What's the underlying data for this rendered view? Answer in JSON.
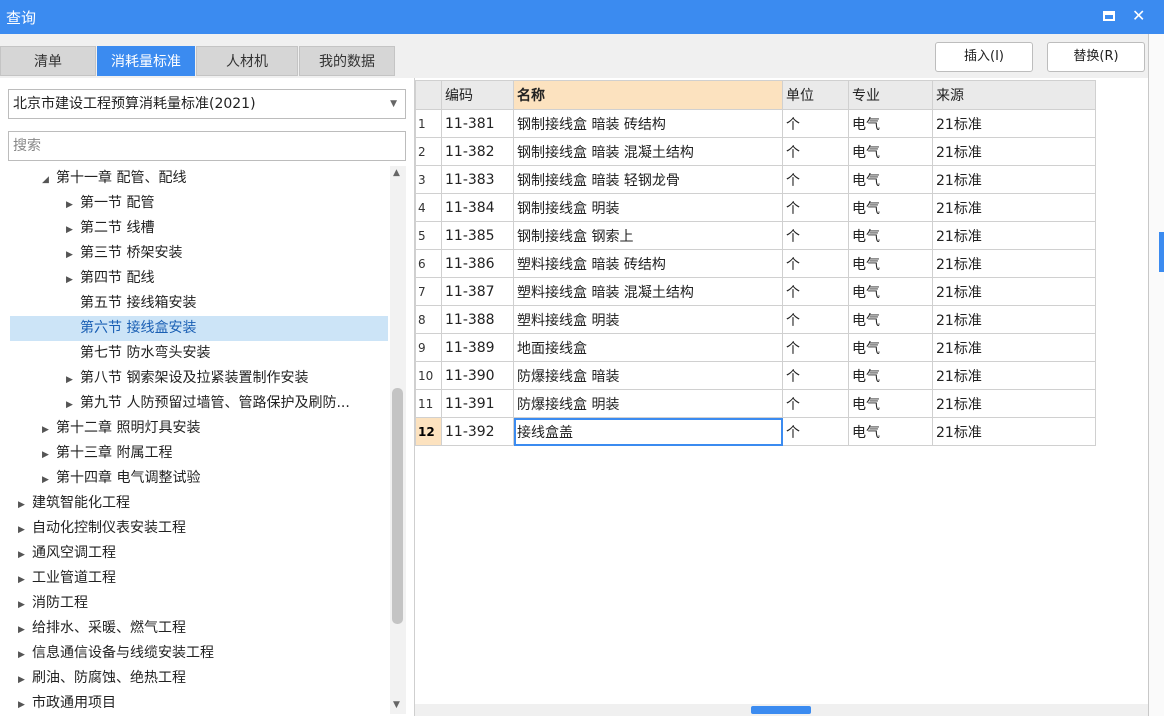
{
  "window": {
    "title": "查询"
  },
  "tabs": [
    {
      "label": "清单",
      "active": false
    },
    {
      "label": "消耗量标准",
      "active": true
    },
    {
      "label": "人材机",
      "active": false
    },
    {
      "label": "我的数据",
      "active": false
    }
  ],
  "actions": {
    "insert_label": "插入(I)",
    "replace_label": "替换(R)"
  },
  "left": {
    "dropdown_value": "北京市建设工程预算消耗量标准(2021)",
    "search_placeholder": "搜索",
    "tree": [
      {
        "label": "第十一章 配管、配线",
        "level": 1,
        "caret": "expanded"
      },
      {
        "label": "第一节 配管",
        "level": 2,
        "caret": "collapsed"
      },
      {
        "label": "第二节 线槽",
        "level": 2,
        "caret": "collapsed"
      },
      {
        "label": "第三节 桥架安装",
        "level": 2,
        "caret": "collapsed"
      },
      {
        "label": "第四节 配线",
        "level": 2,
        "caret": "collapsed"
      },
      {
        "label": "第五节 接线箱安装",
        "level": 2,
        "caret": "none"
      },
      {
        "label": "第六节 接线盒安装",
        "level": 2,
        "caret": "none",
        "selected": true
      },
      {
        "label": "第七节 防水弯头安装",
        "level": 2,
        "caret": "none"
      },
      {
        "label": "第八节 钢索架设及拉紧装置制作安装",
        "level": 2,
        "caret": "collapsed"
      },
      {
        "label": "第九节 人防预留过墙管、管路保护及刷防...",
        "level": 2,
        "caret": "collapsed"
      },
      {
        "label": "第十二章 照明灯具安装",
        "level": 1,
        "caret": "collapsed"
      },
      {
        "label": "第十三章 附属工程",
        "level": 1,
        "caret": "collapsed"
      },
      {
        "label": "第十四章 电气调整试验",
        "level": 1,
        "caret": "collapsed"
      },
      {
        "label": "建筑智能化工程",
        "level": 0,
        "caret": "collapsed"
      },
      {
        "label": "自动化控制仪表安装工程",
        "level": 0,
        "caret": "collapsed"
      },
      {
        "label": "通风空调工程",
        "level": 0,
        "caret": "collapsed"
      },
      {
        "label": "工业管道工程",
        "level": 0,
        "caret": "collapsed"
      },
      {
        "label": "消防工程",
        "level": 0,
        "caret": "collapsed"
      },
      {
        "label": "给排水、采暖、燃气工程",
        "level": 0,
        "caret": "collapsed"
      },
      {
        "label": "信息通信设备与线缆安装工程",
        "level": 0,
        "caret": "collapsed"
      },
      {
        "label": "刷油、防腐蚀、绝热工程",
        "level": 0,
        "caret": "collapsed"
      },
      {
        "label": "市政通用项目",
        "level": 0,
        "caret": "collapsed"
      }
    ]
  },
  "grid": {
    "columns": [
      "编码",
      "名称",
      "单位",
      "专业",
      "来源"
    ],
    "rows": [
      {
        "n": "1",
        "code": "11-381",
        "name": "钢制接线盒 暗装 砖结构",
        "unit": "个",
        "major": "电气",
        "source": "21标准"
      },
      {
        "n": "2",
        "code": "11-382",
        "name": "钢制接线盒 暗装 混凝土结构",
        "unit": "个",
        "major": "电气",
        "source": "21标准"
      },
      {
        "n": "3",
        "code": "11-383",
        "name": "钢制接线盒 暗装 轻钢龙骨",
        "unit": "个",
        "major": "电气",
        "source": "21标准"
      },
      {
        "n": "4",
        "code": "11-384",
        "name": "钢制接线盒 明装",
        "unit": "个",
        "major": "电气",
        "source": "21标准"
      },
      {
        "n": "5",
        "code": "11-385",
        "name": "钢制接线盒 钢索上",
        "unit": "个",
        "major": "电气",
        "source": "21标准"
      },
      {
        "n": "6",
        "code": "11-386",
        "name": "塑料接线盒 暗装 砖结构",
        "unit": "个",
        "major": "电气",
        "source": "21标准"
      },
      {
        "n": "7",
        "code": "11-387",
        "name": "塑料接线盒 暗装 混凝土结构",
        "unit": "个",
        "major": "电气",
        "source": "21标准"
      },
      {
        "n": "8",
        "code": "11-388",
        "name": "塑料接线盒 明装",
        "unit": "个",
        "major": "电气",
        "source": "21标准"
      },
      {
        "n": "9",
        "code": "11-389",
        "name": "地面接线盒",
        "unit": "个",
        "major": "电气",
        "source": "21标准"
      },
      {
        "n": "10",
        "code": "11-390",
        "name": "防爆接线盒 暗装",
        "unit": "个",
        "major": "电气",
        "source": "21标准"
      },
      {
        "n": "11",
        "code": "11-391",
        "name": "防爆接线盒 明装",
        "unit": "个",
        "major": "电气",
        "source": "21标准"
      },
      {
        "n": "12",
        "code": "11-392",
        "name": "接线盒盖",
        "unit": "个",
        "major": "电气",
        "source": "21标准",
        "current": true
      }
    ]
  },
  "colors": {
    "accent": "#3b8bf0",
    "header_highlight": "#fce2bf",
    "selection": "#cce4f7"
  }
}
